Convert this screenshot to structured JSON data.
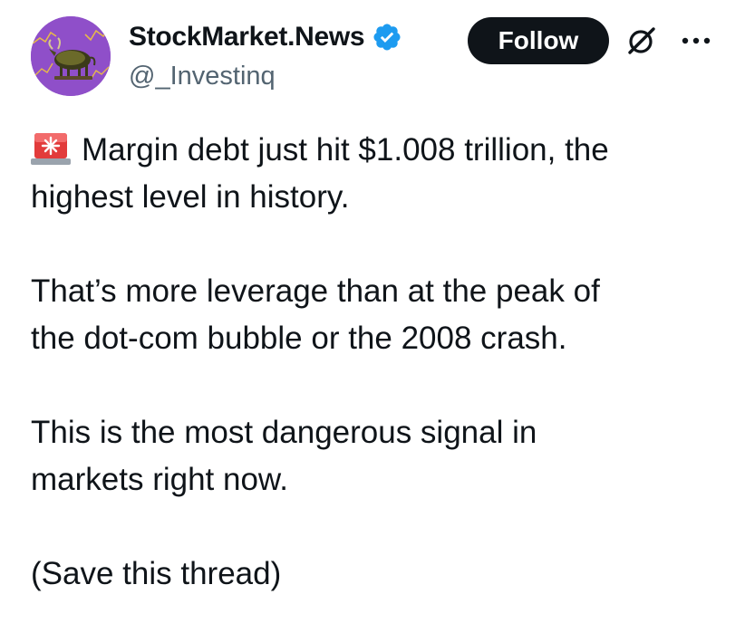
{
  "author": {
    "display_name": "StockMarket.News",
    "handle": "@_Investinq",
    "verified_icon": "verified-badge-icon",
    "avatar_icon": "bull-avatar-icon"
  },
  "actions": {
    "follow_label": "Follow",
    "grok_icon": "grok-icon",
    "more_icon": "more-options-icon"
  },
  "tweet": {
    "emoji": "siren-emoji",
    "paragraphs": [
      {
        "lines": [
          "Margin debt just hit $1.008 trillion, the",
          "highest level in history."
        ]
      },
      {
        "lines": [
          "That’s more leverage than at the peak of",
          "the dot-com bubble or the 2008 crash."
        ]
      },
      {
        "lines": [
          "This is the most dangerous signal in",
          "markets right now."
        ]
      },
      {
        "lines": [
          "(Save this thread)"
        ]
      }
    ]
  },
  "colors": {
    "text": "#0f1419",
    "secondary": "#536471",
    "verified": "#1d9bf0",
    "avatar_bg": "#8f4fc9",
    "button_bg": "#0f1419"
  }
}
